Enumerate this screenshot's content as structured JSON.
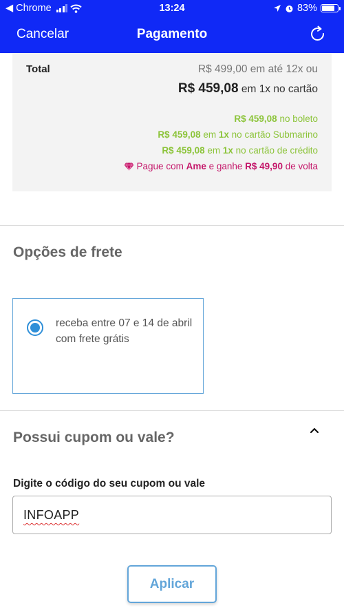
{
  "status_bar": {
    "back_app": "Chrome",
    "time": "13:24",
    "battery": "83%",
    "battery_level": 0.83
  },
  "nav": {
    "cancel_label": "Cancelar",
    "title": "Pagamento",
    "refresh_icon": "refresh-icon",
    "background": "#1029f6"
  },
  "totals": {
    "label": "Total",
    "installments_amount": "R$ 499,00",
    "installments_text": " em até 12x ou",
    "onepay_amount": "R$ 459,08",
    "onepay_text": " em 1x no cartão",
    "boleto_amount": "R$ 459,08",
    "boleto_text": " no boleto",
    "submarino_amount": "R$ 459,08",
    "submarino_mid": " em ",
    "submarino_1x": "1x",
    "submarino_text": " no cartão Submarino",
    "credito_amount": "R$ 459,08",
    "credito_mid": " em ",
    "credito_1x": "1x",
    "credito_text": " no cartão de crédito",
    "ame_prefix": "Pague com ",
    "ame_brand": "Ame",
    "ame_mid": " e ganhe ",
    "ame_amount": "R$ 49,90",
    "ame_suffix": " de volta",
    "ame_icon": "gem-icon",
    "green_color": "#8cc43a",
    "ame_color": "#c4176a"
  },
  "shipping": {
    "title": "Opções de frete",
    "option_text": "receba entre 07 e 14 de abril com frete grátis",
    "option_selected": true
  },
  "coupon": {
    "title": "Possui cupom ou vale?",
    "collapse_icon": "chevron-up-icon",
    "field_label": "Digite o código do seu cupom ou vale",
    "field_value": "INFOAPP",
    "apply_label": "Aplicar",
    "accent_color": "#62a5d9"
  }
}
